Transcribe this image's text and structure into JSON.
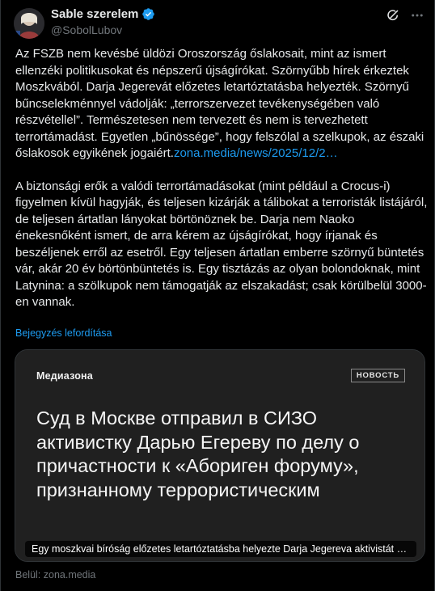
{
  "author": {
    "display_name": "Sable szerelem",
    "handle": "@SobolLubov",
    "verified_color": "#1d9bf0"
  },
  "icons": {
    "grok": "grok-icon",
    "more": "more-icon",
    "verified": "verified-badge-icon"
  },
  "tweet": {
    "paragraph1_text": "Az FSZB nem kevésbé üldözi Oroszország őslakosait, mint az ismert ellenzéki politikusokat és népszerű újságírókat. Szörnyűbb hírek érkeztek Moszkvából. Darja Jegerevát előzetes letartóztatásba helyezték. Szörnyű bűncselekménnyel vádolják: „terrorszervezet tevékenységében való részvétellel”. Természetesen nem tervezett és nem is tervezhetett terrortámadást. Egyetlen „bűnössége”, hogy felszólal a szelkupok, az északi őslakosok egyikének jogaiért.",
    "paragraph1_link": "zona.media/news/2025/12/2…",
    "paragraph2_text": "A biztonsági erők a valódi terrortámadásokat (mint például a Crocus-i) figyelmen kívül hagyják, és teljesen kizárják a tálibokat a terroristák listájáról, de teljesen ártatlan lányokat börtönöznek be. Darja nem Naoko énekesnőként ismert, de arra kérem az újságírókat, hogy írjanak és beszéljenek erről az esetről. Egy teljesen ártatlan emberre szörnyű büntetés vár, akár 20 év börtönbüntetés is. Egy tisztázás az olyan bolondoknak, mint Latynina: a szölkupok nem támogatják az elszakadást; csak körülbelül 3000-en vannak.",
    "translate_label": "Bejegyzés lefordítása"
  },
  "card": {
    "brand": "Медиазона",
    "tag": "НОВОСТЬ",
    "headline": "Суд в Москве отправил в СИЗО активистку Дарью Егереву по делу о причастности к «Абориген форуму», признанному террористическим",
    "caption": "Egy moszkvai bíróság előzetes letartóztatásba helyezte Darja Jegereva aktivistát az Ab…"
  },
  "source_label": "Belül: zona.media",
  "colors": {
    "background": "#000000",
    "text": "#e7e9ea",
    "muted": "#71767b",
    "accent": "#1d9bf0",
    "card_bg": "#202020"
  }
}
